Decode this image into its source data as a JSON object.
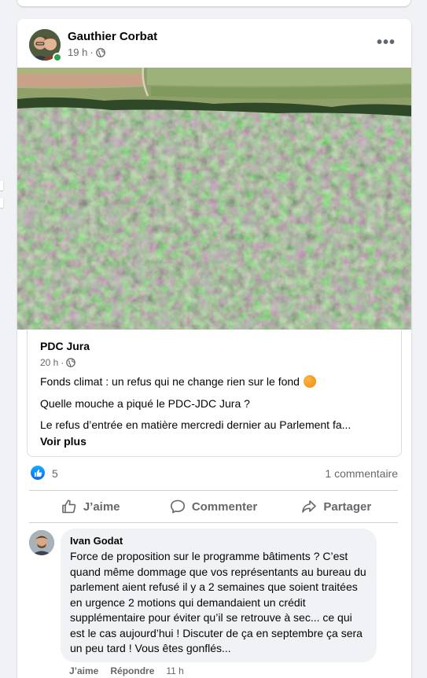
{
  "post": {
    "author": "Gauthier Corbat",
    "time": "19 h",
    "privacy_icon": "globe-icon",
    "more_icon": "more-icon",
    "more_label": "•••"
  },
  "shared": {
    "name": "PDC Jura",
    "time": "20 h",
    "line1": "Fonds climat : un refus qui ne change rien sur le fond",
    "line2": "Quelle mouche a piqué le PDC-JDC Jura ?",
    "line3": "Le refus d’entrée en matière mercredi dernier au Parlement fa...",
    "see_more": "Voir plus"
  },
  "stats": {
    "likes": "5",
    "comments": "1 commentaire"
  },
  "actions": {
    "like": "J’aime",
    "comment": "Commenter",
    "share": "Partager"
  },
  "comment": {
    "author": "Ivan Godat",
    "text": "Force de proposition sur le programme bâtiments ? C’est quand même dommage que vos représentants au bureau du parlement aient refusé il y a 2 semaines que soient traitées en urgence 2 motions qui demandaient un crédit supplémentaire pour éviter qu’il se retrouve à sec... ce qui est le cas aujourd’hui ! Discuter de ça en septembre ça sera un peu tard ! Vous êtes gonflés...",
    "like": "J’aime",
    "reply": "Répondre",
    "time": "11 h"
  },
  "colors": {
    "accent": "#0866ff",
    "online": "#31a24c",
    "muted": "#65676b"
  }
}
